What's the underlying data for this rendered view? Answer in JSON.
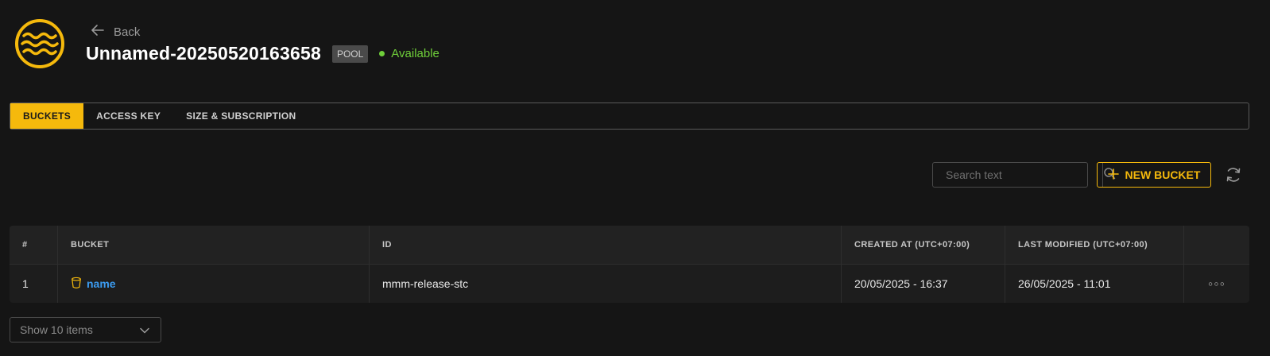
{
  "header": {
    "back_label": "Back",
    "title": "Unnamed-20250520163658",
    "badge": "POOL",
    "status": "Available",
    "logo_icon": "waves-logo-icon"
  },
  "tabs": [
    {
      "label": "BUCKETS",
      "active": true
    },
    {
      "label": "ACCESS KEY",
      "active": false
    },
    {
      "label": "SIZE & SUBSCRIPTION",
      "active": false
    }
  ],
  "toolbar": {
    "search_placeholder": "Search text",
    "new_bucket_label": "NEW BUCKET"
  },
  "table": {
    "columns": [
      "#",
      "BUCKET",
      "ID",
      "CREATED AT (UTC+07:00)",
      "LAST MODIFIED (UTC+07:00)",
      ""
    ],
    "rows": [
      {
        "index": "1",
        "bucket": "name",
        "id": "mmm-release-stc",
        "created_at": "20/05/2025 - 16:37",
        "last_modified": "26/05/2025 - 11:01",
        "actions": "◦◦◦"
      }
    ]
  },
  "pagination": {
    "page_size_label": "Show 10 items"
  },
  "colors": {
    "accent": "#f5b90c",
    "status": "#6fcf3a",
    "link": "#3b9bf0",
    "background": "#151515"
  }
}
